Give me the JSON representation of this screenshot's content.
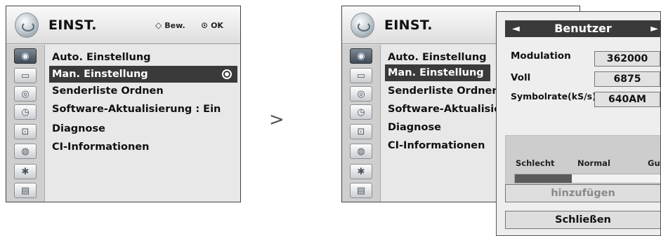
{
  "left_menu": {
    "title": "EINST.",
    "hint_move": "Bew.",
    "hint_ok": "OK",
    "items": [
      "Auto. Einstellung",
      "Man. Einstellung",
      "Senderliste Ordnen",
      "Software-Aktualisierung : Ein",
      "Diagnose",
      "CI-Informationen"
    ]
  },
  "right_menu": {
    "title": "EINST.",
    "items": [
      "Auto. Einstellung",
      "Man. Einstellung",
      "Senderliste Ordnen",
      "Software-Aktualisierur",
      "Diagnose",
      "CI-Informationen"
    ]
  },
  "step_arrow": ">",
  "popup": {
    "mode_prev": "◄",
    "mode_label": "Benutzer",
    "mode_next": "►",
    "fields": [
      {
        "label": "Modulation",
        "value": "362000"
      },
      {
        "label": "Voll",
        "value": "6875"
      },
      {
        "label": "Symbolrate(kS/s)",
        "value": "640AM"
      }
    ],
    "signal": {
      "bad": "Schlecht",
      "normal": "Normal",
      "good": "Gut",
      "level": 0.37
    },
    "add_button": "hinzufügen",
    "close_button": "Schließen"
  },
  "sidebar_icons": [
    "satellite-icon",
    "picture-icon",
    "audio-icon",
    "clock-icon",
    "lock-icon",
    "input-icon",
    "usb-icon",
    "media-icon"
  ]
}
